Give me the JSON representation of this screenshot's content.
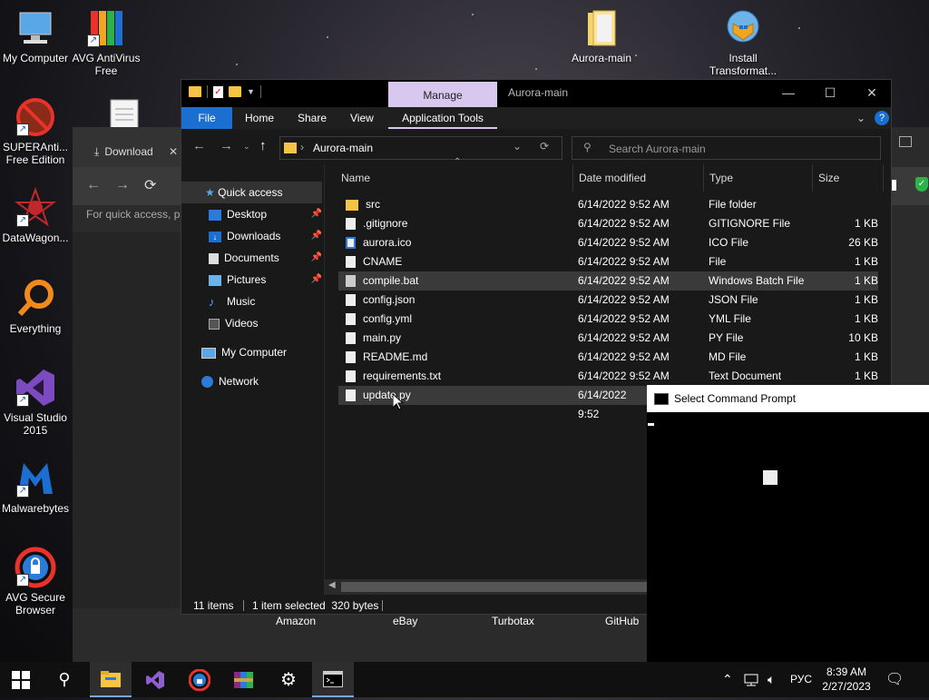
{
  "desktop": {
    "icons": [
      {
        "label": "My Computer"
      },
      {
        "label": "AVG AntiVirus Free"
      },
      {
        "label": "SUPERAnti... Free Edition"
      },
      {
        "label": "DataWagon..."
      },
      {
        "label": "Everything"
      },
      {
        "label": "Visual Studio 2015"
      },
      {
        "label": "Malwarebytes"
      },
      {
        "label": "AVG Secure Browser"
      },
      {
        "label": "Aurora-main"
      },
      {
        "label": "Install Transformat..."
      }
    ]
  },
  "browser": {
    "tab_label": "Download",
    "hint_text": "For quick access, pl",
    "bookmarks": [
      "Amazon",
      "eBay",
      "Turbotax",
      "GitHub"
    ]
  },
  "explorer": {
    "title": "Aurora-main",
    "manage_label": "Manage",
    "ribbon_tabs": [
      "File",
      "Home",
      "Share",
      "View",
      "Application Tools"
    ],
    "address": "Aurora-main",
    "search_placeholder": "Search Aurora-main",
    "nav": {
      "quick_access": "Quick access",
      "items": [
        {
          "label": "Desktop",
          "pinned": true
        },
        {
          "label": "Downloads",
          "pinned": true
        },
        {
          "label": "Documents",
          "pinned": true
        },
        {
          "label": "Pictures",
          "pinned": true
        },
        {
          "label": "Music",
          "pinned": false
        },
        {
          "label": "Videos",
          "pinned": false
        }
      ],
      "my_computer": "My Computer",
      "network": "Network"
    },
    "columns": [
      "Name",
      "Date modified",
      "Type",
      "Size"
    ],
    "files": [
      {
        "name": "src",
        "date": "6/14/2022 9:52 AM",
        "type": "File folder",
        "size": ""
      },
      {
        "name": ".gitignore",
        "date": "6/14/2022 9:52 AM",
        "type": "GITIGNORE File",
        "size": "1 KB"
      },
      {
        "name": "aurora.ico",
        "date": "6/14/2022 9:52 AM",
        "type": "ICO File",
        "size": "26 KB"
      },
      {
        "name": "CNAME",
        "date": "6/14/2022 9:52 AM",
        "type": "File",
        "size": "1 KB"
      },
      {
        "name": "compile.bat",
        "date": "6/14/2022 9:52 AM",
        "type": "Windows Batch File",
        "size": "1 KB"
      },
      {
        "name": "config.json",
        "date": "6/14/2022 9:52 AM",
        "type": "JSON File",
        "size": "1 KB"
      },
      {
        "name": "config.yml",
        "date": "6/14/2022 9:52 AM",
        "type": "YML File",
        "size": "1 KB"
      },
      {
        "name": "main.py",
        "date": "6/14/2022 9:52 AM",
        "type": "PY File",
        "size": "10 KB"
      },
      {
        "name": "README.md",
        "date": "6/14/2022 9:52 AM",
        "type": "MD File",
        "size": "1 KB"
      },
      {
        "name": "requirements.txt",
        "date": "6/14/2022 9:52 AM",
        "type": "Text Document",
        "size": "1 KB"
      },
      {
        "name": "update.py",
        "date": "6/14/2022 9:52",
        "type": "",
        "size": ""
      }
    ],
    "status": {
      "count": "11 items",
      "selection": "1 item selected  320 bytes"
    }
  },
  "cmd": {
    "title": "Select Command Prompt"
  },
  "taskbar": {
    "language": "РУС",
    "time": "8:39 AM",
    "date": "2/27/2023"
  },
  "colors": {
    "accent": "#1a6fd1",
    "folder": "#f6c445",
    "manage_tab": "#d8c8f0"
  }
}
